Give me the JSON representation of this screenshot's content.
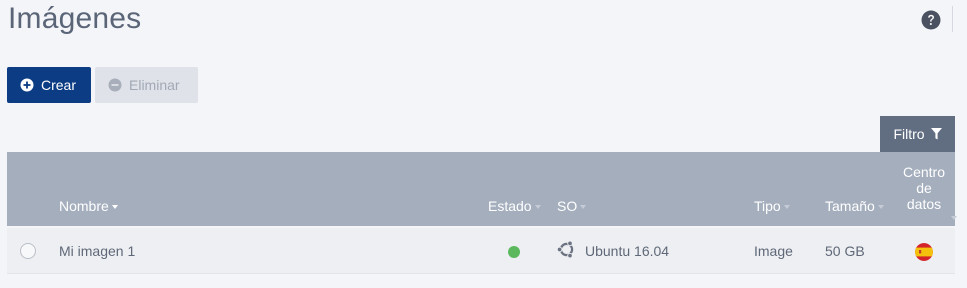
{
  "header": {
    "title": "Imágenes",
    "help_icon": "question-circle-icon"
  },
  "toolbar": {
    "create_label": "Crear",
    "create_icon": "plus-circle-icon",
    "delete_label": "Eliminar",
    "delete_icon": "minus-circle-icon",
    "filter_label": "Filtro",
    "filter_icon": "funnel-icon"
  },
  "table": {
    "columns": {
      "name": "Nombre",
      "status": "Estado",
      "os": "SO",
      "type": "Tipo",
      "size": "Tamaño",
      "datacenter_line1": "Centro",
      "datacenter_line2": "de",
      "datacenter_line3": "datos"
    },
    "sorted_column": "Nombre",
    "rows": [
      {
        "name": "Mi imagen 1",
        "status": "active",
        "status_color": "#5bb85d",
        "os": "Ubuntu 16.04",
        "os_icon": "ubuntu-icon",
        "type": "Image",
        "size": "50 GB",
        "datacenter_flag": "spain-flag-icon"
      }
    ]
  },
  "colors": {
    "primary": "#0b3c84",
    "header_bg": "#a4aebd",
    "filter_bg": "#616d80",
    "background": "#f4f5f8"
  }
}
